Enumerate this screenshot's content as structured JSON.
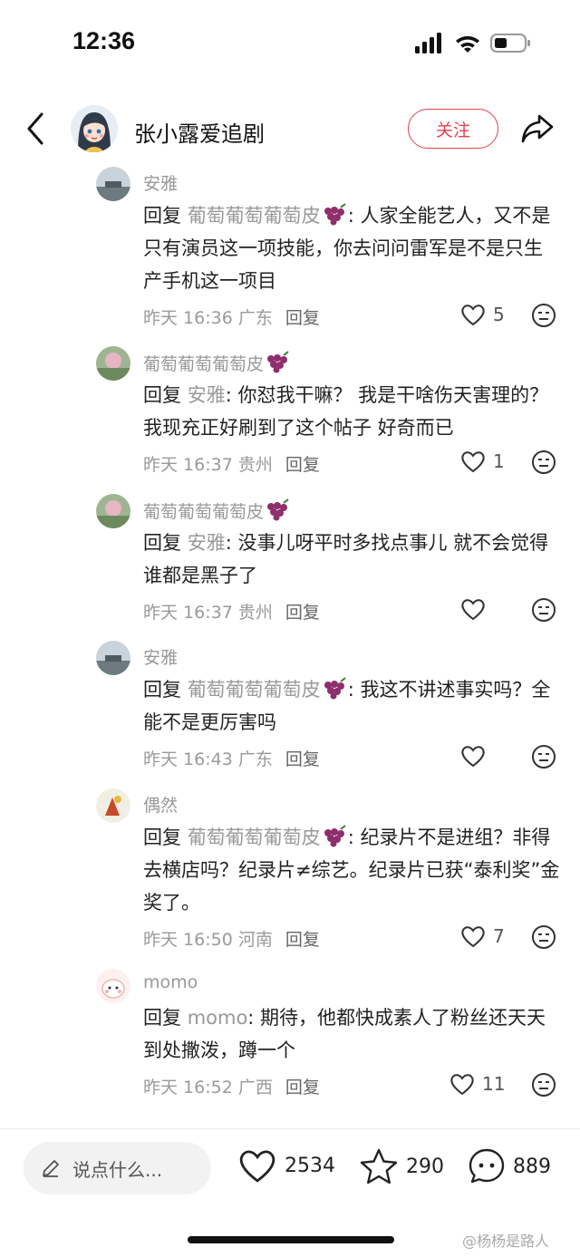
{
  "status": {
    "time": "12:36"
  },
  "header": {
    "author_name": "张小露爱追剧",
    "follow_label": "关注"
  },
  "comments": [
    {
      "name": "安雅",
      "reply_word": "回复",
      "reply_target": "葡萄葡萄葡萄皮",
      "text": ": 人家全能艺人，又不是只有演员这一项技能，你去问问雷军是不是只生产手机这一项目",
      "time": "昨天 16:36 广东",
      "reply_label": "回复",
      "likes": "5"
    },
    {
      "name": "葡萄葡萄葡萄皮",
      "reply_word": "回复",
      "reply_target": "安雅",
      "text": ": 你怼我干嘛？ 我是干啥伤天害理的？ 我现充正好刷到了这个帖子 好奇而已",
      "time": "昨天 16:37 贵州",
      "reply_label": "回复",
      "likes": "1"
    },
    {
      "name": "葡萄葡萄葡萄皮",
      "reply_word": "回复",
      "reply_target": "安雅",
      "text": ": 没事儿呀平时多找点事儿 就不会觉得谁都是黑子了",
      "time": "昨天 16:37 贵州",
      "reply_label": "回复",
      "likes": ""
    },
    {
      "name": "安雅",
      "reply_word": "回复",
      "reply_target": "葡萄葡萄葡萄皮",
      "text": ": 我这不讲述事实吗？全能不是更厉害吗",
      "time": "昨天 16:43 广东",
      "reply_label": "回复",
      "likes": ""
    },
    {
      "name": "偶然",
      "reply_word": "回复",
      "reply_target": "葡萄葡萄葡萄皮",
      "text": ": 纪录片不是进组？非得去横店吗？纪录片≠综艺。纪录片已获“泰利奖”金奖了。",
      "time": "昨天 16:50 河南",
      "reply_label": "回复",
      "likes": "7"
    },
    {
      "name": "momo",
      "reply_word": "回复",
      "reply_target": "momo",
      "text": ": 期待，他都快成素人了粉丝还天天到处撒泼，蹲一个",
      "time": "昨天 16:52 广西",
      "reply_label": "回复",
      "likes": "11"
    }
  ],
  "bottom": {
    "input_placeholder": "说点什么...",
    "likes": "2534",
    "stars": "290",
    "comments": "889"
  },
  "watermark": "@杨杨是路人",
  "colors": {
    "accent": "#e5404f",
    "muted": "#999999"
  }
}
